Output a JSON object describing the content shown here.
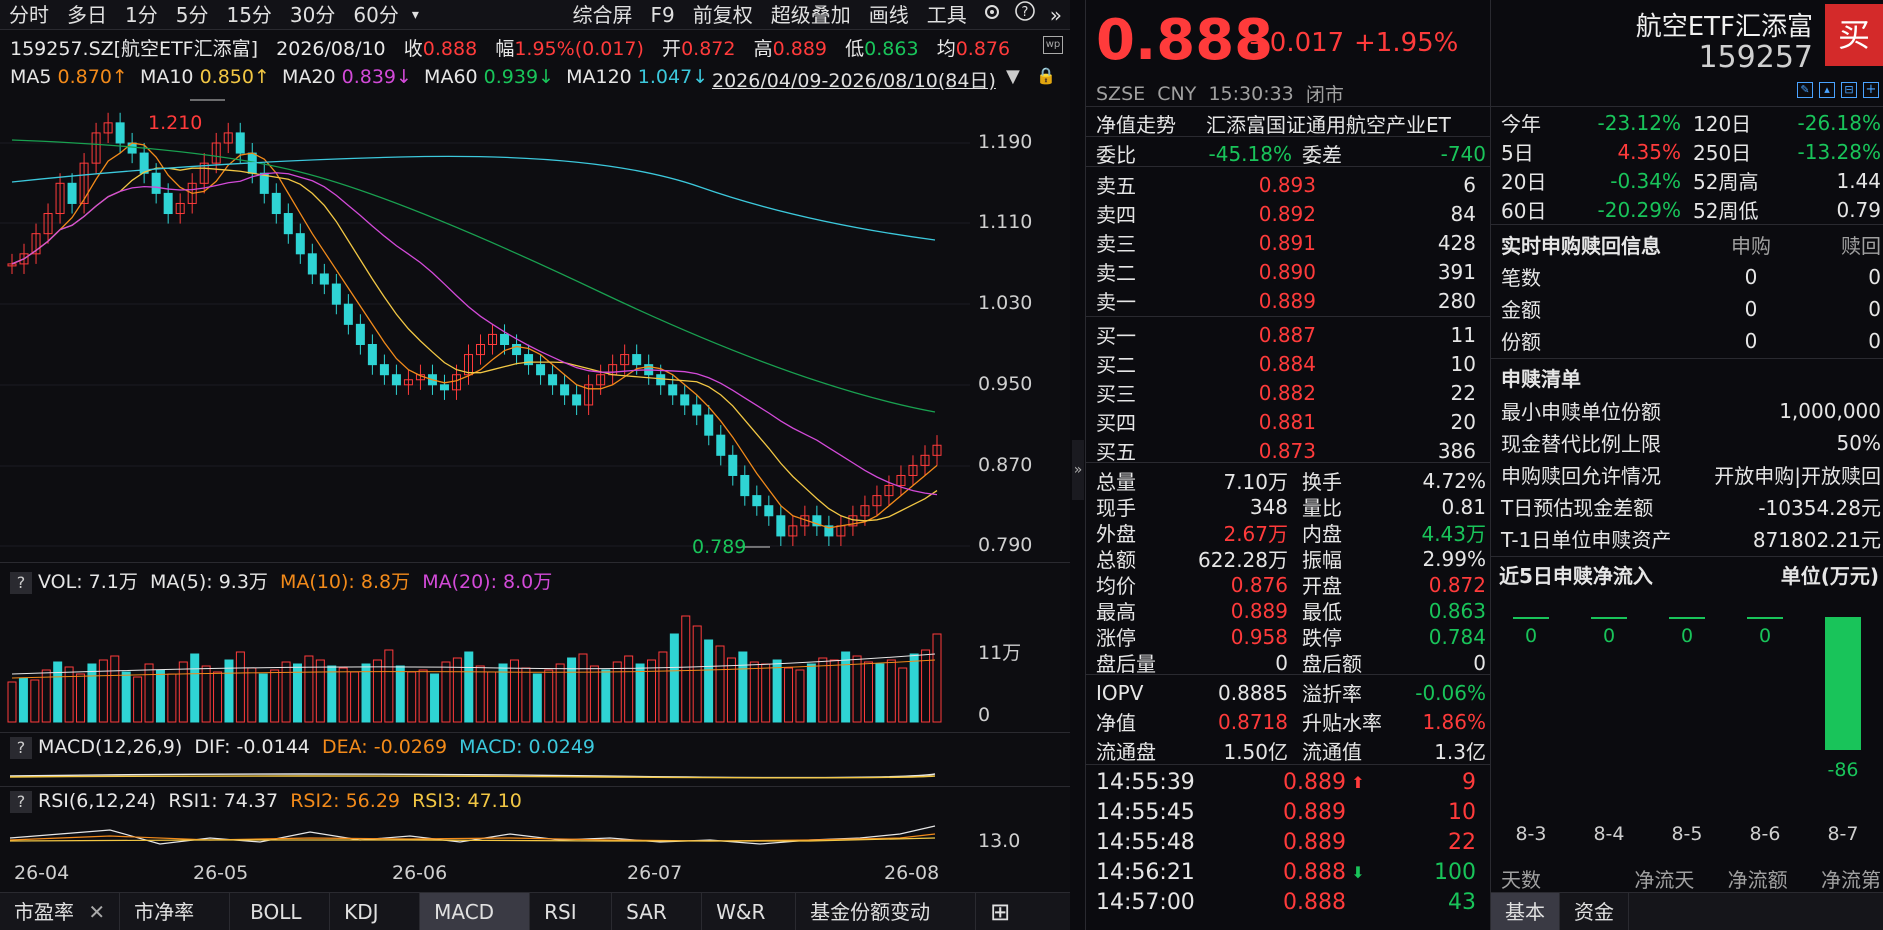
{
  "toolbar": {
    "left_items": [
      "分时",
      "多日",
      "1分",
      "5分",
      "15分",
      "30分",
      "60分",
      "▾"
    ],
    "right_items": [
      "综合屏",
      "F9",
      "前复权",
      "超级叠加",
      "画线",
      "工具"
    ]
  },
  "info": {
    "code": "159257.SZ[航空ETF汇添富]",
    "date": "2026/08/10",
    "close_label": "收",
    "close": "0.888",
    "pct_label": "幅",
    "pct": "1.95%(0.017)",
    "open_label": "开",
    "open": "0.872",
    "high_label": "高",
    "high": "0.889",
    "low_label": "低",
    "low": "0.863",
    "avg_label": "均",
    "avg": "0.876"
  },
  "ma": {
    "ma5_label": "MA5",
    "ma5": "0.870↑",
    "ma10_label": "MA10",
    "ma10": "0.850↑",
    "ma20_label": "MA20",
    "ma20": "0.839↓",
    "ma60_label": "MA60",
    "ma60": "0.939↓",
    "ma120_label": "MA120",
    "ma120": "1.047↓",
    "range": "2026/04/09-2026/08/10(84日)"
  },
  "price_axis": [
    "1.190",
    "1.110",
    "1.030",
    "0.950",
    "0.870",
    "0.790"
  ],
  "annotations": {
    "high": "1.210",
    "low": "0.789"
  },
  "vol": {
    "label": "VOL: 7.1万",
    "ma5": "MA(5): 9.3万",
    "ma10": "MA(10): 8.8万",
    "ma20": "MA(20): 8.0万",
    "axis_top": "11万",
    "axis_zero": "0"
  },
  "macd": {
    "label": "MACD(12,26,9)",
    "dif": "DIF: -0.0144",
    "dea": "DEA: -0.0269",
    "macd": "MACD: 0.0249"
  },
  "rsi": {
    "label": "RSI(6,12,24)",
    "rsi1": "RSI1: 74.37",
    "rsi2": "RSI2: 56.29",
    "rsi3": "RSI3: 47.10",
    "axis": "13.0"
  },
  "date_axis": [
    "26-04",
    "26-05",
    "26-06",
    "26-07",
    "26-08"
  ],
  "bottom_tabs": [
    "市盈率",
    "市净率",
    "BOLL",
    "KDJ",
    "MACD",
    "RSI",
    "SAR",
    "W&R",
    "基金份额变动"
  ],
  "quote": {
    "price": "0.888",
    "change": "+0.017",
    "change_pct": "+1.95%",
    "name": "航空ETF汇添富",
    "code": "159257",
    "buy": "买",
    "exchange": "SZSE",
    "currency": "CNY",
    "time": "15:30:33",
    "status": "闭市"
  },
  "nav_trend": {
    "label": "净值走势",
    "name": "汇添富国证通用航空产业ET"
  },
  "weibi": {
    "label": "委比",
    "value": "-45.18%",
    "diff_label": "委差",
    "diff": "-740"
  },
  "asks": [
    {
      "label": "卖五",
      "price": "0.893",
      "vol": "6"
    },
    {
      "label": "卖四",
      "price": "0.892",
      "vol": "84"
    },
    {
      "label": "卖三",
      "price": "0.891",
      "vol": "428"
    },
    {
      "label": "卖二",
      "price": "0.890",
      "vol": "391"
    },
    {
      "label": "卖一",
      "price": "0.889",
      "vol": "280"
    }
  ],
  "bids": [
    {
      "label": "买一",
      "price": "0.887",
      "vol": "11"
    },
    {
      "label": "买二",
      "price": "0.884",
      "vol": "10"
    },
    {
      "label": "买三",
      "price": "0.882",
      "vol": "22"
    },
    {
      "label": "买四",
      "price": "0.881",
      "vol": "20"
    },
    {
      "label": "买五",
      "price": "0.873",
      "vol": "386"
    }
  ],
  "stats": [
    {
      "l1": "总量",
      "v1": "7.10万",
      "c1": "white",
      "l2": "换手",
      "v2": "4.72%",
      "c2": "white"
    },
    {
      "l1": "现手",
      "v1": "348",
      "c1": "white",
      "l2": "量比",
      "v2": "0.81",
      "c2": "white"
    },
    {
      "l1": "外盘",
      "v1": "2.67万",
      "c1": "red",
      "l2": "内盘",
      "v2": "4.43万",
      "c2": "green"
    },
    {
      "l1": "总额",
      "v1": "622.28万",
      "c1": "white",
      "l2": "振幅",
      "v2": "2.99%",
      "c2": "white"
    },
    {
      "l1": "均价",
      "v1": "0.876",
      "c1": "red",
      "l2": "开盘",
      "v2": "0.872",
      "c2": "red"
    },
    {
      "l1": "最高",
      "v1": "0.889",
      "c1": "red",
      "l2": "最低",
      "v2": "0.863",
      "c2": "green"
    },
    {
      "l1": "涨停",
      "v1": "0.958",
      "c1": "red",
      "l2": "跌停",
      "v2": "0.784",
      "c2": "green"
    },
    {
      "l1": "盘后量",
      "v1": "0",
      "c1": "white",
      "l2": "盘后额",
      "v2": "0",
      "c2": "white"
    }
  ],
  "stats2": [
    {
      "l1": "IOPV",
      "v1": "0.8885",
      "c1": "white",
      "l2": "溢折率",
      "v2": "-0.06%",
      "c2": "green"
    },
    {
      "l1": "净值",
      "v1": "0.8718",
      "c1": "red",
      "l2": "升贴水率",
      "v2": "1.86%",
      "c2": "red"
    },
    {
      "l1": "流通盘",
      "v1": "1.50亿",
      "c1": "white",
      "l2": "流通值",
      "v2": "1.3亿",
      "c2": "white"
    }
  ],
  "trades": [
    {
      "time": "14:55:39",
      "price": "0.889",
      "vol": "9",
      "dir": "up",
      "vc": "red"
    },
    {
      "time": "14:55:45",
      "price": "0.889",
      "vol": "10",
      "dir": "",
      "vc": "red"
    },
    {
      "time": "14:55:48",
      "price": "0.889",
      "vol": "22",
      "dir": "",
      "vc": "red"
    },
    {
      "time": "14:56:21",
      "price": "0.888",
      "vol": "100",
      "dir": "down",
      "vc": "green"
    },
    {
      "time": "14:57:00",
      "price": "0.888",
      "vol": "43",
      "dir": "",
      "vc": "green"
    }
  ],
  "perf": [
    {
      "l1": "今年",
      "v1": "-23.12%",
      "c1": "green",
      "l2": "120日",
      "v2": "-26.18%",
      "c2": "green"
    },
    {
      "l1": "5日",
      "v1": "4.35%",
      "c1": "red",
      "l2": "250日",
      "v2": "-13.28%",
      "c2": "green"
    },
    {
      "l1": "20日",
      "v1": "-0.34%",
      "c1": "green",
      "l2": "52周高",
      "v2": "1.44",
      "c2": "white"
    },
    {
      "l1": "60日",
      "v1": "-20.29%",
      "c1": "green",
      "l2": "52周低",
      "v2": "0.79",
      "c2": "white"
    }
  ],
  "subred": {
    "title": "实时申购赎回信息",
    "col1": "申购",
    "col2": "赎回",
    "rows": [
      {
        "label": "笔数",
        "v1": "0",
        "v2": "0"
      },
      {
        "label": "金额",
        "v1": "0",
        "v2": "0"
      },
      {
        "label": "份额",
        "v1": "0",
        "v2": "0"
      }
    ]
  },
  "list": {
    "title": "申赎清单",
    "rows": [
      {
        "label": "最小申赎单位份额",
        "value": "1,000,000"
      },
      {
        "label": "现金替代比例上限",
        "value": "50%"
      },
      {
        "label": "申购赎回允许情况",
        "value": "开放申购|开放赎回"
      },
      {
        "label": "T日预估现金差额",
        "value": "-10354.28元"
      },
      {
        "label": "T-1日单位申赎资产",
        "value": "871802.21元"
      }
    ]
  },
  "flow": {
    "title": "近5日申赎净流入",
    "unit": "单位(万元)",
    "days": [
      "8-3",
      "8-4",
      "8-5",
      "8-6",
      "8-7"
    ],
    "values": [
      0,
      0,
      0,
      0,
      -86
    ],
    "labels": [
      "0",
      "0",
      "0",
      "0",
      "-86"
    ]
  },
  "flow_footer": {
    "c1": "天数",
    "c2": "净流天",
    "c3": "净流额",
    "c4": "净流第"
  },
  "right_tabs": [
    "基本",
    "资金"
  ]
}
